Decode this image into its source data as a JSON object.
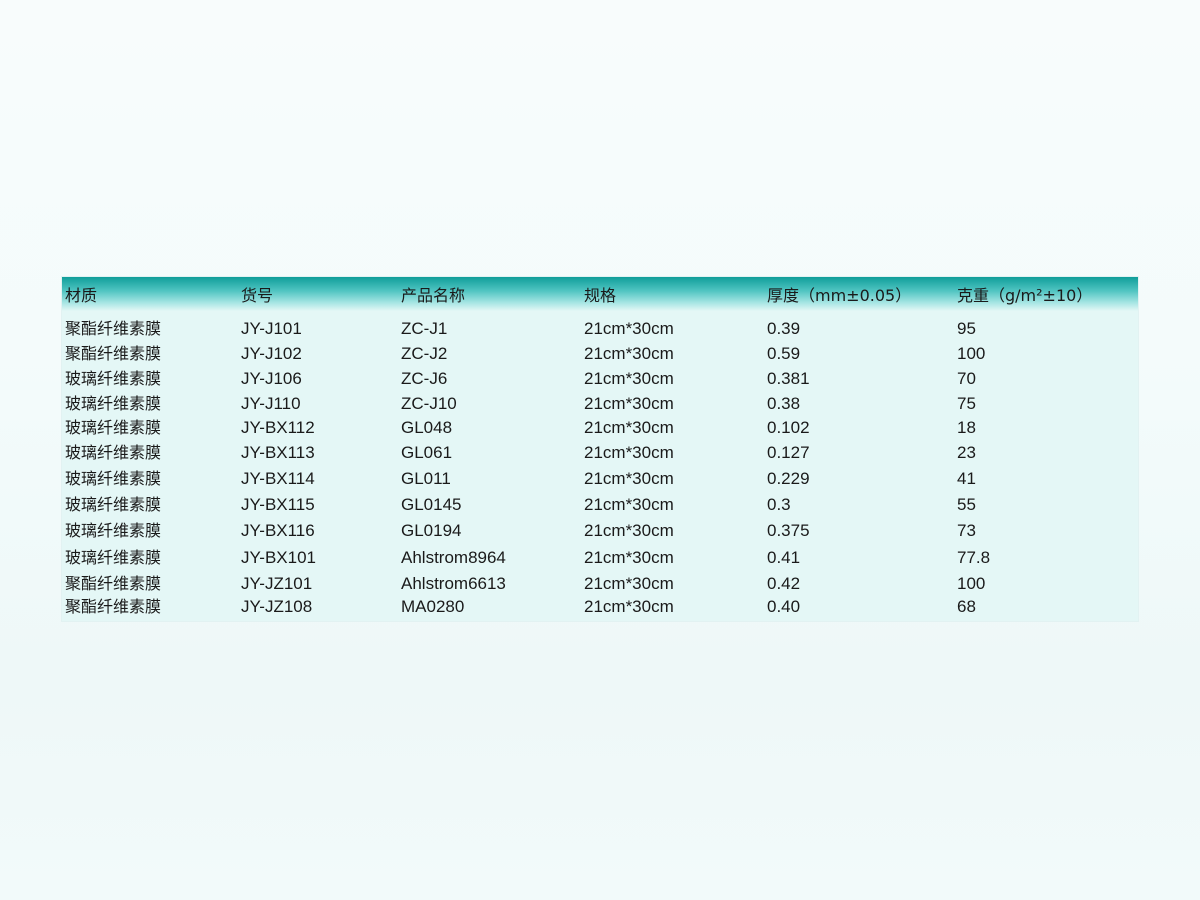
{
  "table": {
    "headers": [
      "材质",
      "货号",
      "产品名称",
      "规格",
      "厚度（mm±0.05）",
      "克重（g/m²±10）"
    ],
    "rows": [
      [
        "聚酯纤维素膜",
        "JY-J101",
        "ZC-J1",
        "21cm*30cm",
        "0.39",
        "95"
      ],
      [
        "聚酯纤维素膜",
        "JY-J102",
        "ZC-J2",
        "21cm*30cm",
        "0.59",
        "100"
      ],
      [
        "玻璃纤维素膜",
        "JY-J106",
        "ZC-J6",
        "21cm*30cm",
        "0.381",
        "70"
      ],
      [
        "玻璃纤维素膜",
        "JY-J110",
        "ZC-J10",
        "21cm*30cm",
        "0.38",
        "75"
      ],
      [
        "玻璃纤维素膜",
        "JY-BX112",
        "GL048",
        "21cm*30cm",
        "0.102",
        "18"
      ],
      [
        "玻璃纤维素膜",
        "JY-BX113",
        "GL061",
        "21cm*30cm",
        "0.127",
        "23"
      ],
      [
        "玻璃纤维素膜",
        "JY-BX114",
        "GL011",
        "21cm*30cm",
        "0.229",
        "41"
      ],
      [
        "玻璃纤维素膜",
        "JY-BX115",
        "GL0145",
        "21cm*30cm",
        "0.3",
        "55"
      ],
      [
        "玻璃纤维素膜",
        "JY-BX116",
        "GL0194",
        "21cm*30cm",
        "0.375",
        "73"
      ],
      [
        "玻璃纤维素膜",
        "JY-BX101",
        "Ahlstrom8964",
        "21cm*30cm",
        "0.41",
        "77.8"
      ],
      [
        "聚酯纤维素膜",
        "JY-JZ101",
        "Ahlstrom6613",
        "21cm*30cm",
        "0.42",
        "100"
      ],
      [
        "聚酯纤维素膜",
        "JY-JZ108",
        "MA0280",
        "21cm*30cm",
        "0.40",
        "68"
      ]
    ]
  },
  "colors": {
    "header_top": "#0f9e9a",
    "table_bg": "#e4f7f6",
    "page_bg": "#f6fbfb"
  }
}
